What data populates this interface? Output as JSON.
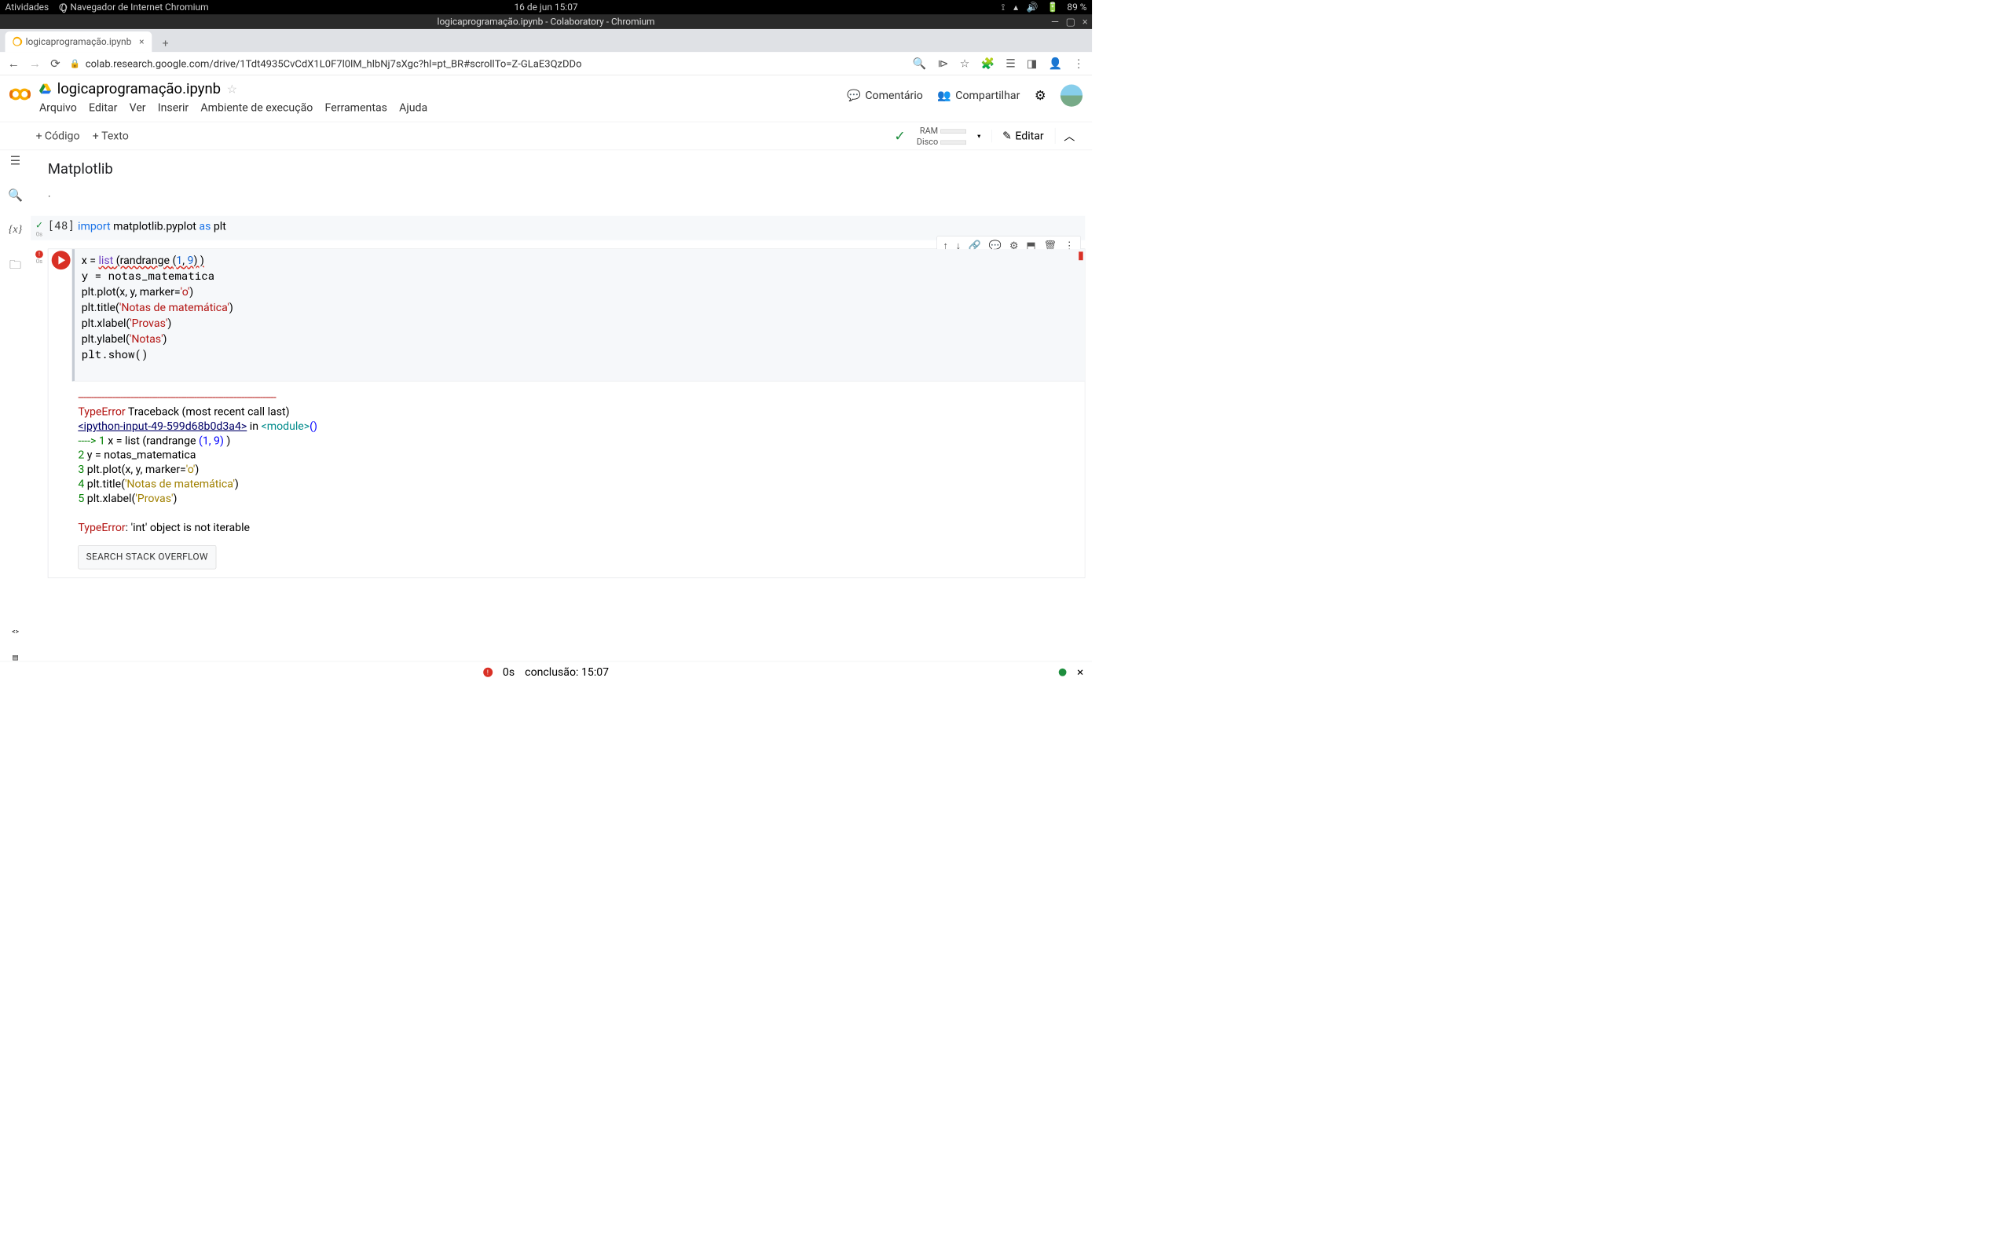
{
  "gnome": {
    "activities": "Atividades",
    "app_name": "Navegador de Internet Chromium",
    "clock": "16 de jun  15:07",
    "battery": "89 %"
  },
  "browser": {
    "window_title": "logicaprogramação.ipynb - Colaboratory - Chromium",
    "tab_title": "logicaprogramação.ipynb",
    "url": "colab.research.google.com/drive/1Tdt4935CvCdX1L0F7l0lM_hlbNj7sXgc?hl=pt_BR#scrollTo=Z-GLaE3QzDDo"
  },
  "colab": {
    "filename": "logicaprogramação.ipynb",
    "menu": [
      "Arquivo",
      "Editar",
      "Ver",
      "Inserir",
      "Ambiente de execução",
      "Ferramentas",
      "Ajuda"
    ],
    "comment": "Comentário",
    "share": "Compartilhar"
  },
  "toolbar": {
    "code": "Código",
    "text": "Texto",
    "ram": "RAM",
    "disk": "Disco",
    "edit": "Editar"
  },
  "section": {
    "title": "Matplotlib"
  },
  "cell1": {
    "number": "[48]",
    "kw_import": "import",
    "mod": " matplotlib.pyplot ",
    "kw_as": "as",
    "alias": " plt",
    "time": "0s"
  },
  "cell2": {
    "time": "0s",
    "code": {
      "l1a": "x = ",
      "l1b": "list",
      "l1c": " (randrange ",
      "l1d": "(",
      "l1e": "1",
      "l1f": ", ",
      "l1g": "9",
      "l1h": ") )",
      "l2": "y = notas_matematica",
      "l3a": "plt.plot(x, y, marker=",
      "l3b": "'o'",
      "l3c": ")",
      "l4a": "plt.title(",
      "l4b": "'Notas de matemática'",
      "l4c": ")",
      "l5a": "plt.xlabel(",
      "l5b": "'Provas'",
      "l5c": ")",
      "l6a": "plt.ylabel(",
      "l6b": "'Notas'",
      "l6c": ")",
      "l7": "plt.show()"
    },
    "output": {
      "divider": "---------------------------------------------------------------------------",
      "errtype": "TypeError",
      "tbhead": "                                 Traceback (most recent call last)",
      "link": "<ipython-input-49-599d68b0d3a4>",
      "in": " in ",
      "module": "<module>",
      "parens": "()",
      "arrow": "----> 1",
      "l1a": " x = list (randrange ",
      "l1b": "(1, 9)",
      "l1c": " )",
      "n2": "      2",
      "l2": " y = notas_matematica",
      "n3": "      3",
      "l3a": " plt.plot(x, y, marker=",
      "l3b": "'o'",
      "l3c": ")",
      "n4": "      4",
      "l4a": " plt.title(",
      "l4b": "'Notas de matemática'",
      "l4c": ")",
      "n5": "      5",
      "l5a": " plt.xlabel(",
      "l5b": "'Provas'",
      "l5c": ")",
      "final_type": "TypeError",
      "final_msg": ": 'int' object is not iterable",
      "so_btn": "SEARCH STACK OVERFLOW"
    }
  },
  "bottom": {
    "time": "0s",
    "status": "conclusão: 15:07"
  }
}
